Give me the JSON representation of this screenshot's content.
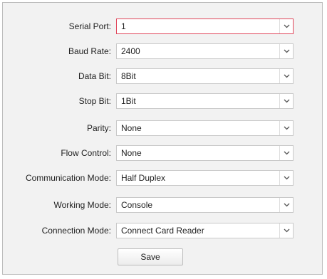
{
  "form": {
    "fields": [
      {
        "label": "Serial Port:",
        "value": "1"
      },
      {
        "label": "Baud Rate:",
        "value": "2400"
      },
      {
        "label": "Data Bit:",
        "value": "8Bit"
      },
      {
        "label": "Stop Bit:",
        "value": "1Bit"
      },
      {
        "label": "Parity:",
        "value": "None"
      },
      {
        "label": "Flow Control:",
        "value": "None"
      },
      {
        "label": "Communication Mode:",
        "value": "Half Duplex"
      },
      {
        "label": "Working Mode:",
        "value": "Console"
      },
      {
        "label": "Connection Mode:",
        "value": "Connect Card Reader"
      }
    ],
    "save_label": "Save"
  },
  "icons": {
    "dropdown": "chevron-down-icon"
  },
  "colors": {
    "panel_background": "#f2f2f2",
    "focused_border": "#e0455a"
  }
}
